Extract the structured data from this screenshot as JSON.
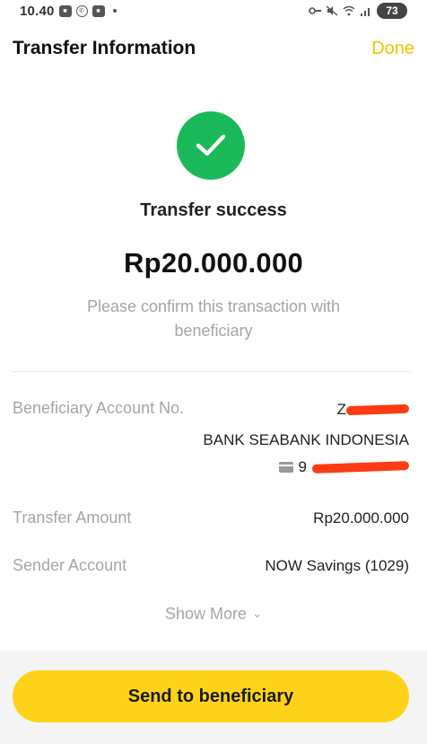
{
  "status_bar": {
    "time": "10.40",
    "battery": "73"
  },
  "header": {
    "title": "Transfer Information",
    "done_label": "Done"
  },
  "result": {
    "title": "Transfer success",
    "amount": "Rp20.000.000",
    "note": "Please confirm this transaction with beneficiary",
    "icon": "check-icon",
    "color": "#19b95a"
  },
  "details": {
    "beneficiary_label": "Beneficiary Account No.",
    "beneficiary_name_visible": "Z",
    "beneficiary_bank": "BANK SEABANK INDONESIA",
    "beneficiary_number_visible": "9",
    "transfer_amount_label": "Transfer Amount",
    "transfer_amount_value": "Rp20.000.000",
    "sender_label": "Sender Account",
    "sender_value": "NOW Savings (1029)"
  },
  "show_more": {
    "label": "Show More"
  },
  "actions": {
    "primary_label": "Send to beneficiary",
    "primary_color": "#ffd21a"
  },
  "colors": {
    "accent": "#f2c200",
    "redaction": "#ff3b12"
  }
}
